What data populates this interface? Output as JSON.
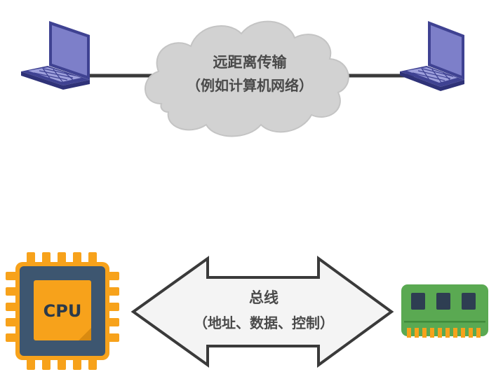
{
  "network": {
    "title": "远距离传输",
    "subtitle": "（例如计算机网络）"
  },
  "bus": {
    "title": "总线",
    "subtitle": "（地址、数据、控制）"
  },
  "cpu": {
    "label": "CPU"
  },
  "colors": {
    "laptop_screen": "#7d7fc9",
    "laptop_frame": "#3f4292",
    "cloud": "#d2d2d2",
    "wire": "#3a3a3a",
    "cpu_orange": "#f7a21b",
    "cpu_body": "#3d5670",
    "ram_green": "#5aa952",
    "arrow_fill": "#f4f4f4"
  }
}
